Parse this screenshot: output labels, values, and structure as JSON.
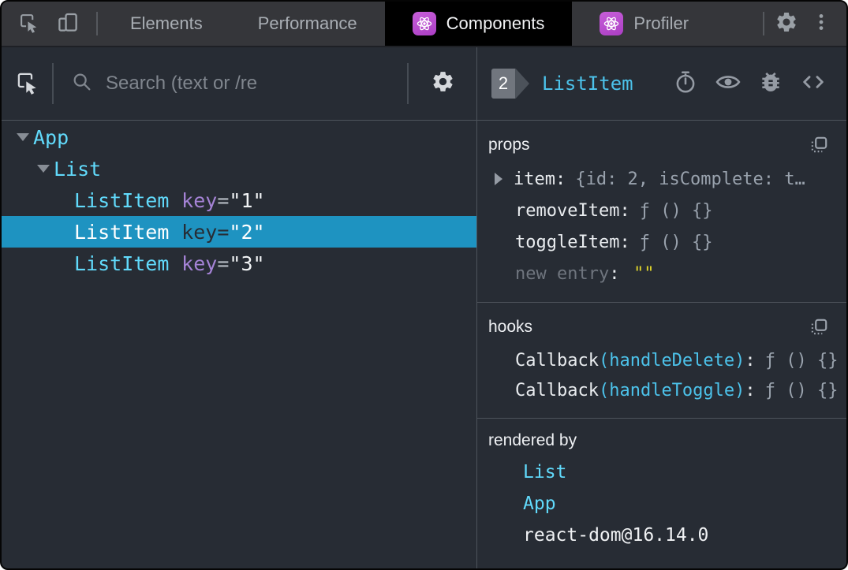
{
  "topbar": {
    "tabs": [
      {
        "label": "Elements"
      },
      {
        "label": "Performance"
      },
      {
        "label": "Components"
      },
      {
        "label": "Profiler"
      }
    ],
    "icons": [
      "inspect-element",
      "toggle-device-toolbar",
      "react-logo",
      "settings-gear",
      "more-options-kebab"
    ]
  },
  "left_panel": {
    "toolbar": {
      "search_placeholder": "Search (text or /re",
      "icons": [
        "inspect-component",
        "search-magnifier",
        "settings-gear"
      ]
    },
    "tree": [
      {
        "name": "App"
      },
      {
        "name": "List"
      },
      {
        "name": "ListItem",
        "attr": "key",
        "value": "\"1\""
      },
      {
        "name": "ListItem",
        "attr": "key",
        "value": "\"2\""
      },
      {
        "name": "ListItem",
        "attr": "key",
        "value": "\"3\""
      }
    ]
  },
  "right_panel": {
    "header": {
      "badge": "2",
      "component": "ListItem",
      "icons": [
        "suspend-stopwatch",
        "inspect-matching-dom-eye",
        "log-component-bug",
        "view-source-code"
      ]
    },
    "props": {
      "title": "props",
      "rows": [
        {
          "name": "item",
          "value": "{id: 2, isComplete: t…"
        },
        {
          "name": "removeItem",
          "value": "ƒ () {}"
        },
        {
          "name": "toggleItem",
          "value": "ƒ () {}"
        },
        {
          "name": "new entry",
          "value": "\"\""
        }
      ]
    },
    "hooks": {
      "title": "hooks",
      "rows": [
        {
          "name": "Callback",
          "arg": "(handleDelete)",
          "value": "ƒ () {}"
        },
        {
          "name": "Callback",
          "arg": "(handleToggle)",
          "value": "ƒ () {}"
        }
      ]
    },
    "rendered_by": {
      "title": "rendered by",
      "rows": [
        {
          "label": "List"
        },
        {
          "label": "App"
        },
        {
          "label": "react-dom@16.14.0"
        }
      ]
    }
  },
  "tokens": {
    "eq": "=",
    "colon": ":"
  },
  "colors": {
    "component_name": "#61dafb",
    "attribute_name": "#a583d6",
    "selection_background": "#1e93c1",
    "editable_empty_value": "#ddd32b",
    "react_badge": "#ba4fce",
    "topbar_background": "#35363a",
    "panel_background": "#272c34",
    "active_tab_background": "#000000"
  }
}
